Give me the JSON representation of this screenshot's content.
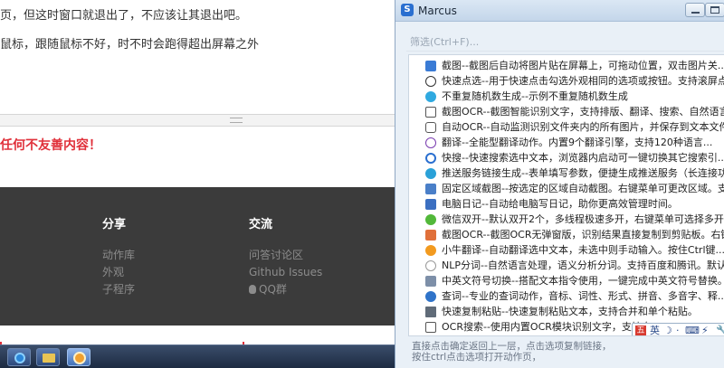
{
  "background_page": {
    "line1": "页，但这时窗口就退出了，不应该让其退出吧。",
    "line2": "鼠标，跟随鼠标不好，时不时会跑得超出屏幕之外",
    "warning": "任何不友善内容！",
    "footer": {
      "share_title": "分享",
      "share_links": [
        "动作库",
        "外观",
        "子程序"
      ],
      "talk_title": "交流",
      "talk_links": [
        "问答讨论区",
        "Github Issues",
        "QQ群"
      ]
    }
  },
  "window": {
    "title": "Marcus",
    "filter_placeholder": "筛选(Ctrl+F)...",
    "items": [
      {
        "icon": "image-icon",
        "text": "截图--截图后自动将图片贴在屏幕上，可拖动位置，双击图片关..."
      },
      {
        "icon": "check-circle-icon",
        "text": "快速点选--用于快速点击勾选外观相同的选项或按钮。支持滚屏点选..."
      },
      {
        "icon": "lightbulb-icon",
        "text": "不重复随机数生成--示例不重复随机数生成"
      },
      {
        "icon": "ocr-icon",
        "text": "截图OCR--截图智能识别文字，支持排版、翻译、搜索、自然语言处..."
      },
      {
        "icon": "auto-ocr-icon",
        "text": "自动OCR--自动监测识别文件夹内的所有图片，并保存到文本文件。"
      },
      {
        "icon": "translate-icon",
        "text": "翻译--全能型翻译动作。内置9个翻译引擎，支持120种语言..."
      },
      {
        "icon": "search-icon",
        "text": "快搜--快速搜索选中文本，浏览器内启动可一键切换其它搜索引..."
      },
      {
        "icon": "push-service-icon",
        "text": "推送服务链接生成--表单填写参数，便捷生成推送服务（长连接功能）的链接"
      },
      {
        "icon": "region-screenshot-icon",
        "text": "固定区域截图--按选定的区域自动截图。右键菜单可更改区域。支持设置..."
      },
      {
        "icon": "diary-icon",
        "text": "电脑日记--自动给电脑写日记，助你更高效管理时间。"
      },
      {
        "icon": "wechat-icon",
        "text": "微信双开--默认双开2个，多线程极速多开，右键菜单可选择多开数..."
      },
      {
        "icon": "copy-icon",
        "text": "截图OCR--截图OCR无弹窗版，识别结果直接复制到剪贴板。右键..."
      },
      {
        "icon": "calf-icon",
        "text": "小牛翻译--自动翻译选中文本，未选中则手动输入。按住Ctrl键..."
      },
      {
        "icon": "nlp-icon",
        "text": "NLP分词--自然语言处理，语义分析分词。支持百度和腾讯。默认搞..."
      },
      {
        "icon": "switch-icon",
        "text": "中英文符号切换--搭配文本指令使用，一键完成中英文符号替换。"
      },
      {
        "icon": "dictionary-icon",
        "text": "查词--专业的查词动作，音标、词性、形式、拼音、多音字、释..."
      },
      {
        "icon": "paste-icon",
        "text": "快速复制粘贴--快速复制粘贴文本，支持合并和单个粘贴。"
      },
      {
        "icon": "ocr-search-icon",
        "text": "OCR搜索--使用内置OCR模块识别文字，支持自"
      }
    ],
    "ime_bar": [
      "五",
      "英",
      "☽",
      "·",
      "⌨",
      "⚡",
      "🔧"
    ],
    "hints": [
      "直接点击确定返回上一层，点击选项复制链接，",
      "按住ctrl点击选项打开动作页，"
    ]
  }
}
